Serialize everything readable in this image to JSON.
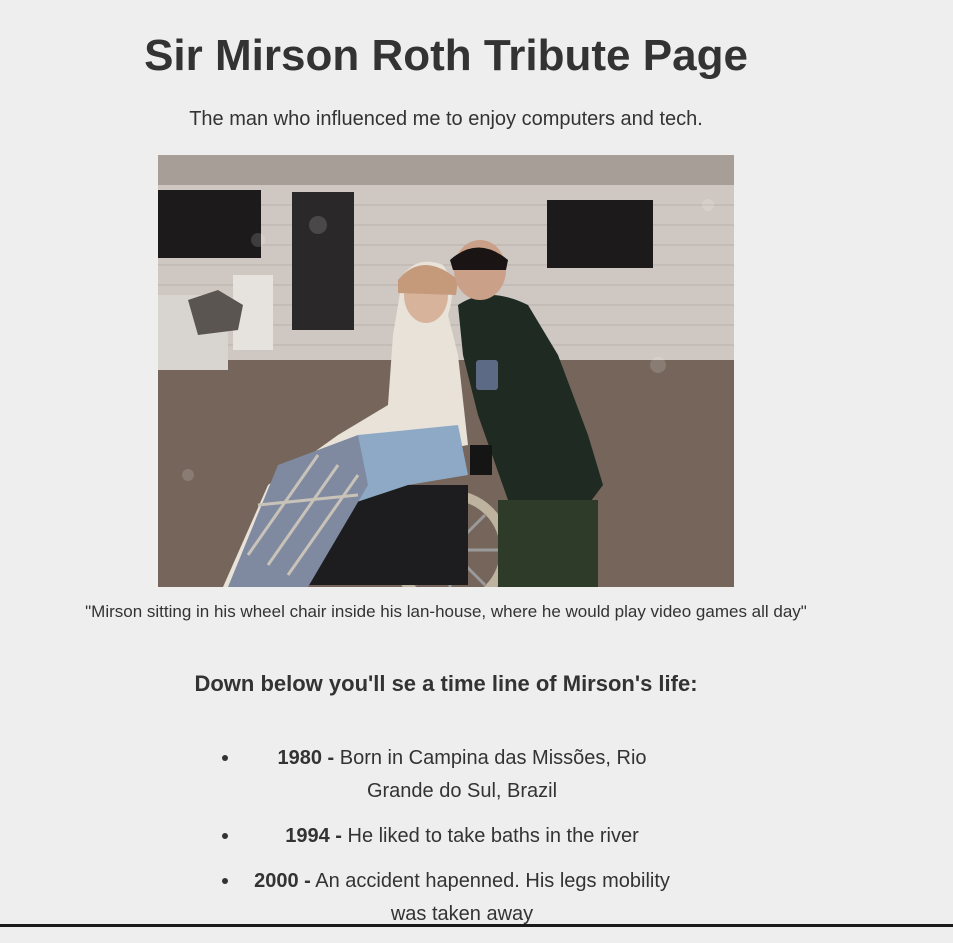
{
  "page": {
    "title": "Sir Mirson Roth Tribute Page",
    "subtitle": "The man who influenced me to enjoy computers and tech.",
    "image_caption": "\"Mirson sitting in his wheel chair inside his lan-house, where he would play video games all day\"",
    "tribute_heading": "Down below you'll se a time line of Mirson's life:"
  },
  "timeline": [
    {
      "year": "1980 -",
      "text": " Born in Campina das Missões, Rio Grande do Sul, Brazil"
    },
    {
      "year": "1994 -",
      "text": " He liked to take baths in the river"
    },
    {
      "year": "2000 -",
      "text": " An accident hapenned. His legs mobility was taken away"
    }
  ],
  "colors": {
    "background": "#eeeeee",
    "text": "#333333"
  }
}
